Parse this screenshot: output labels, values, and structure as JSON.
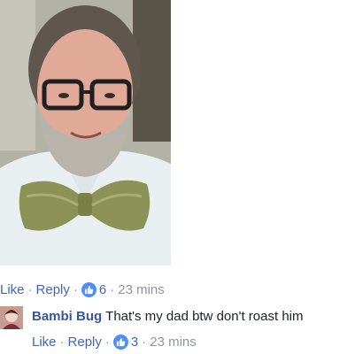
{
  "post_photo": {
    "alt": ""
  },
  "post_actions": {
    "like": "Like",
    "reply": "Reply",
    "reactions": "6",
    "time": "23 mins",
    "separator": "·"
  },
  "comment": {
    "author": "Bambi Bug",
    "text": "That's my dad btw don't roast him",
    "actions": {
      "like": "Like",
      "reply": "Reply",
      "reactions": "3",
      "time": "23 mins",
      "separator": "·"
    }
  },
  "colors": {
    "link": "#4267b2",
    "author": "#365899",
    "meta": "#90949c",
    "like_badge": "#4c8ff7"
  },
  "icons": {
    "reaction": "thumbs-up-icon"
  }
}
